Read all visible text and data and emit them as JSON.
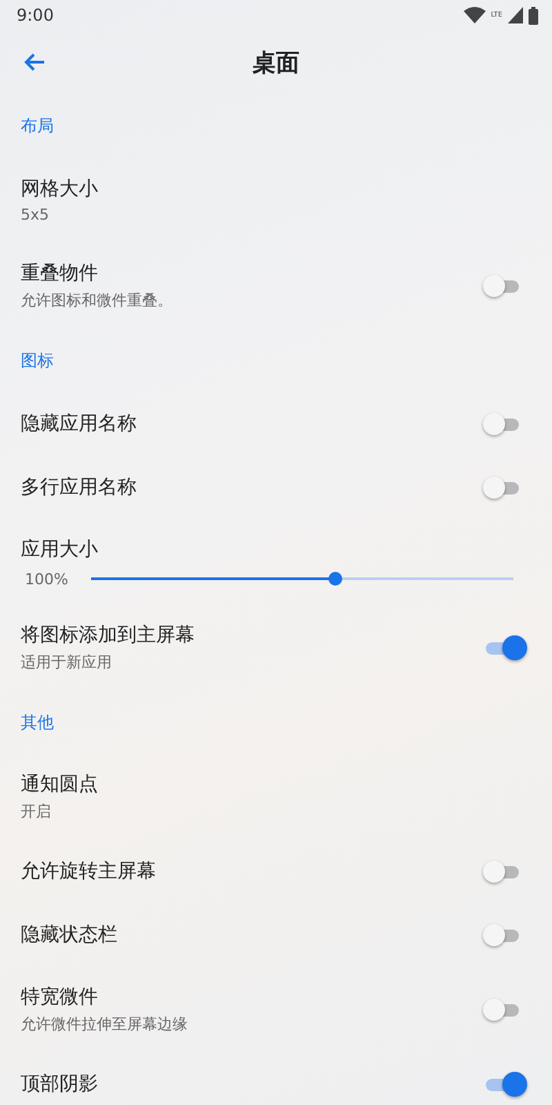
{
  "status_bar": {
    "time": "9:00",
    "network": "LTE"
  },
  "toolbar": {
    "title": "桌面"
  },
  "sections": [
    {
      "header": "布局",
      "items": [
        {
          "kind": "text",
          "title": "网格大小",
          "subtitle": "5x5"
        },
        {
          "kind": "toggle",
          "title": "重叠物件",
          "subtitle": "允许图标和微件重叠。",
          "on": false
        }
      ]
    },
    {
      "header": "图标",
      "items": [
        {
          "kind": "toggle",
          "title": "隐藏应用名称",
          "on": false
        },
        {
          "kind": "toggle",
          "title": "多行应用名称",
          "on": false
        },
        {
          "kind": "slider",
          "title": "应用大小",
          "reading": "100%",
          "level": 0.58
        },
        {
          "kind": "toggle",
          "title": "将图标添加到主屏幕",
          "subtitle": "适用于新应用",
          "on": true
        }
      ]
    },
    {
      "header": "其他",
      "items": [
        {
          "kind": "text",
          "title": "通知圆点",
          "subtitle": "开启"
        },
        {
          "kind": "toggle",
          "title": "允许旋转主屏幕",
          "on": false
        },
        {
          "kind": "toggle",
          "title": "隐藏状态栏",
          "on": false
        },
        {
          "kind": "toggle",
          "title": "特宽微件",
          "subtitle": "允许微件拉伸至屏幕边缘",
          "on": false
        },
        {
          "kind": "toggle",
          "title": "顶部阴影",
          "on": true
        }
      ]
    }
  ]
}
